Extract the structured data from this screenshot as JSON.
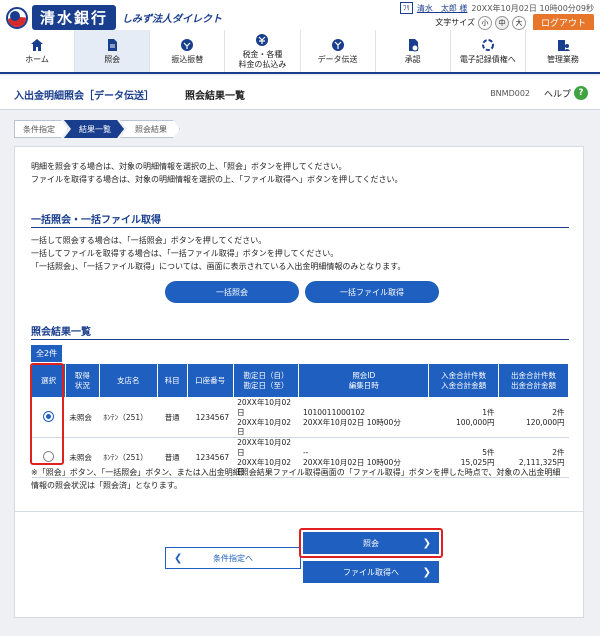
{
  "bank": {
    "name": "清水銀行",
    "service": "しみず法人ダイレクト"
  },
  "user": {
    "badge": "ﾌﾘ",
    "name": "清水　太郎 様",
    "timestamp": "20XX年10月02日 10時00分09秒"
  },
  "font_size": {
    "label": "文字サイズ",
    "small": "小",
    "medium": "中",
    "large": "大"
  },
  "logout_label": "ログアウト",
  "nav": [
    {
      "label": "ホーム",
      "icon": "home-icon"
    },
    {
      "label": "照会",
      "icon": "document-icon"
    },
    {
      "label": "振込振替",
      "icon": "transfer-icon"
    },
    {
      "label": "税金・各種\n料金の払込み",
      "icon": "tax-icon"
    },
    {
      "label": "データ伝送",
      "icon": "data-transfer-icon"
    },
    {
      "label": "承認",
      "icon": "approval-icon"
    },
    {
      "label": "電子記録債権へ",
      "icon": "link-icon"
    },
    {
      "label": "管理業務",
      "icon": "admin-icon"
    }
  ],
  "page": {
    "title": "入出金明細照会［データ伝送］",
    "subtitle": "照会結果一覧",
    "screen_id": "BNMD002",
    "help_label": "ヘルプ"
  },
  "steps": [
    "条件指定",
    "結果一覧",
    "照会結果"
  ],
  "intro": {
    "line1": "明細を照会する場合は、対象の明細情報を選択の上、「照会」ボタンを押してください。",
    "line2": "ファイルを取得する場合は、対象の明細情報を選択の上、「ファイル取得へ」ボタンを押してください。"
  },
  "bulk": {
    "title": "一括照会・一括ファイル取得",
    "line1": "一括して照会する場合は、「一括照会」ボタンを押してください。",
    "line2": "一括してファイルを取得する場合は、「一括ファイル取得」ボタンを押してください。",
    "line3": "「一括照会」、「一括ファイル取得」については、画面に表示されている入出金明細情報のみとなります。",
    "bulk_inquiry_label": "一括照会",
    "bulk_file_label": "一括ファイル取得"
  },
  "results": {
    "title": "照会結果一覧",
    "count": "全2件",
    "headers": {
      "select": "選択",
      "status": "取得\n状況",
      "branch": "支店名",
      "subject": "科目",
      "account": "口座番号",
      "date": "勘定日（自）\n勘定日（至）",
      "inquiry_id": "照会ID\n編集日時",
      "deposit": "入金合計件数\n入金合計金額",
      "withdrawal": "出金合計件数\n出金合計金額"
    },
    "rows": [
      {
        "selected": true,
        "status": "未照会",
        "branch": "ﾎﾝﾃﾝ（251）",
        "subject": "普通",
        "account": "1234567",
        "date_from": "20XX年10月02日",
        "date_to": "20XX年10月02日",
        "inquiry_id": "1010011000102",
        "edited": "20XX年10月02日 10時00分",
        "deposit_count": "1件",
        "deposit_amount": "100,000円",
        "withdrawal_count": "2件",
        "withdrawal_amount": "120,000円"
      },
      {
        "selected": false,
        "status": "未照会",
        "branch": "ﾎﾝﾃﾝ（251）",
        "subject": "普通",
        "account": "1234567",
        "date_from": "20XX年10月02日",
        "date_to": "20XX年10月02日",
        "inquiry_id": "--",
        "edited": "20XX年10月02日 10時00分",
        "deposit_count": "5件",
        "deposit_amount": "15,025円",
        "withdrawal_count": "2件",
        "withdrawal_amount": "2,111,325円"
      }
    ],
    "note_line1": "※「照会」ボタン、「一括照会」ボタン、または入出金明細照会結果ファイル取得画面の「ファイル取得」ボタンを押した時点で、対象の入出金明細",
    "note_line2": "情報の照会状況は「照会済」となります。"
  },
  "actions": {
    "back_label": "条件指定へ",
    "inquiry_label": "照会",
    "file_label": "ファイル取得へ"
  },
  "colors": {
    "primary": "#1f5fbf",
    "brand": "#1a3e8e",
    "logout": "#e8762a",
    "highlight": "#e02020"
  }
}
